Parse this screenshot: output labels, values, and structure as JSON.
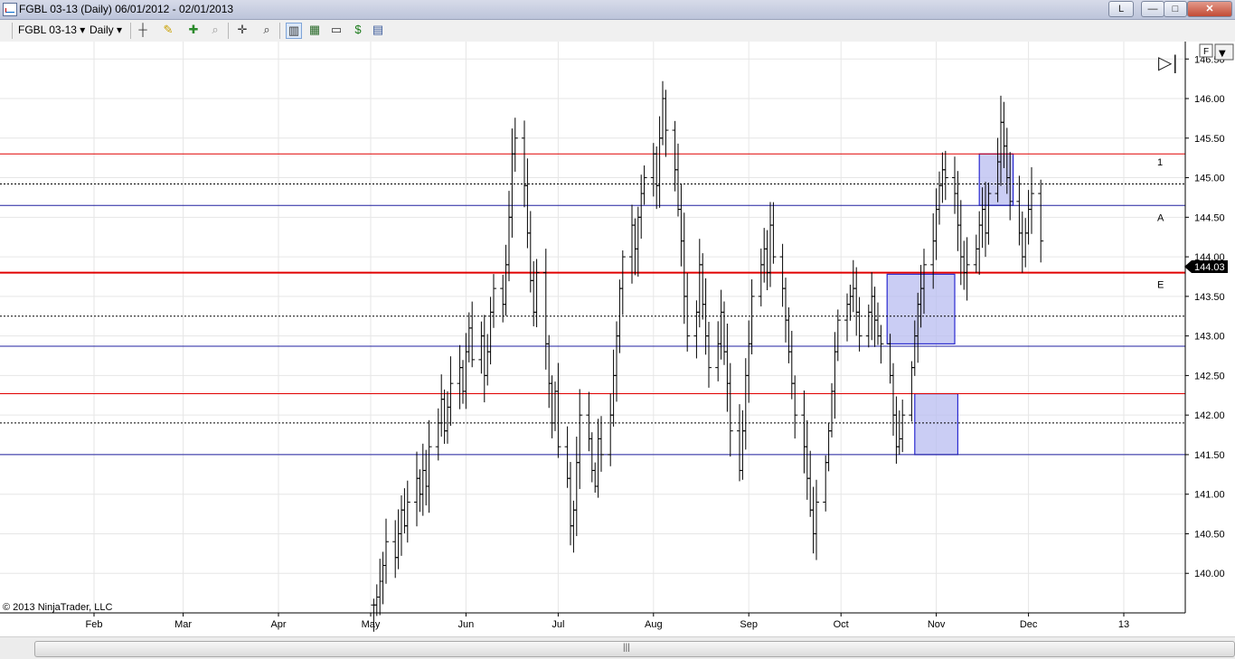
{
  "window": {
    "title": "FGBL 03-13 (Daily)  06/01/2012 - 02/01/2013",
    "buttons": {
      "layout": "L",
      "minimize": "—",
      "maximize": "□",
      "close": "✕"
    }
  },
  "toolbar": {
    "instrument": "FGBL 03-13",
    "period": "Daily",
    "icons": [
      "bar-style-icon",
      "drawing-pencil-icon",
      "add-indicator-icon",
      "zoom-icon",
      "crosshair-icon",
      "magnify-icon",
      "chart-bars-icon",
      "candlestick-icon",
      "chart-window-icon",
      "dollar-icon",
      "properties-icon"
    ]
  },
  "chart_controls": {
    "f_label": "F",
    "dropdown": "▼",
    "scroll_end": "▷|"
  },
  "copyright": "© 2013 NinjaTrader, LLC",
  "colors": {
    "red_line": "#e00000",
    "blue_line": "#2020a0",
    "black_line": "#000000",
    "box_fill": "#b8bcf0",
    "box_border": "#2a2ad0",
    "grid": "#e6e6e6",
    "bars": "#000000"
  },
  "chart_data": {
    "type": "bar",
    "title": "FGBL 03-13 (Daily)",
    "ylim": [
      139.5,
      146.72
    ],
    "y_ticks": [
      "146.50",
      "146.00",
      "145.50",
      "145.00",
      "144.50",
      "144.00",
      "143.50",
      "143.00",
      "142.50",
      "142.00",
      "141.50",
      "141.00",
      "140.50",
      "140.00"
    ],
    "x_ticks": [
      {
        "label": "Feb",
        "day": 0
      },
      {
        "label": "Mar",
        "day": 29
      },
      {
        "label": "Apr",
        "day": 60
      },
      {
        "label": "May",
        "day": 90
      },
      {
        "label": "Jun",
        "day": 121
      },
      {
        "label": "Jul",
        "day": 151
      },
      {
        "label": "Aug",
        "day": 182
      },
      {
        "label": "Sep",
        "day": 213
      },
      {
        "label": "Oct",
        "day": 243
      },
      {
        "label": "Nov",
        "day": 274
      },
      {
        "label": "Dec",
        "day": 304
      },
      {
        "label": "13",
        "day": 335
      }
    ],
    "current_price": "144.03",
    "horizontal_lines": [
      {
        "y": 145.3,
        "color": "red",
        "style": "solid",
        "width": 1
      },
      {
        "y": 144.92,
        "color": "black",
        "style": "dashed",
        "width": 1
      },
      {
        "y": 144.65,
        "color": "blue",
        "style": "solid",
        "width": 1
      },
      {
        "y": 143.8,
        "color": "red",
        "style": "solid",
        "width": 2
      },
      {
        "y": 143.25,
        "color": "black",
        "style": "dashed",
        "width": 1
      },
      {
        "y": 142.87,
        "color": "blue",
        "style": "solid",
        "width": 1
      },
      {
        "y": 142.27,
        "color": "red",
        "style": "solid",
        "width": 1
      },
      {
        "y": 141.9,
        "color": "black",
        "style": "dashed",
        "width": 1
      },
      {
        "y": 141.5,
        "color": "blue",
        "style": "solid",
        "width": 1
      }
    ],
    "line_labels": [
      {
        "text": "1",
        "y": 145.2
      },
      {
        "text": "A",
        "y": 144.5
      },
      {
        "text": "E",
        "y": 143.65
      }
    ],
    "zones": [
      {
        "day_start": 258,
        "day_end": 280,
        "y_low": 142.9,
        "y_high": 143.78
      },
      {
        "day_start": 267,
        "day_end": 281,
        "y_low": 141.5,
        "y_high": 142.27
      },
      {
        "day_start": 288,
        "day_end": 299,
        "y_low": 144.65,
        "y_high": 145.3
      }
    ],
    "bars_start_day": 91,
    "closes": [
      139.6,
      139.7,
      139.9,
      140.1,
      140.4,
      140.2,
      140.5,
      140.8,
      140.6,
      140.9,
      141.2,
      141.0,
      141.3,
      141.1,
      141.6,
      141.9,
      142.2,
      141.8,
      142.1,
      142.4,
      142.6,
      142.3,
      142.8,
      143.1,
      142.7,
      143.0,
      142.5,
      142.8,
      143.3,
      143.6,
      143.4,
      143.9,
      144.5,
      145.3,
      145.5,
      144.9,
      144.3,
      143.7,
      143.3,
      143.8,
      142.9,
      142.4,
      141.9,
      142.3,
      141.6,
      141.2,
      140.6,
      140.8,
      141.4,
      142.0,
      141.7,
      141.3,
      141.1,
      141.7,
      141.5,
      142.0,
      142.5,
      143.0,
      143.6,
      144.0,
      144.4,
      144.1,
      144.5,
      144.8,
      145.0,
      145.3,
      144.9,
      145.5,
      146.0,
      145.6,
      145.1,
      144.6,
      144.2,
      143.5,
      143.0,
      143.3,
      143.9,
      143.4,
      143.0,
      142.6,
      142.9,
      143.3,
      142.8,
      142.4,
      141.8,
      141.3,
      141.8,
      142.5,
      142.9,
      143.5,
      143.9,
      144.1,
      143.8,
      144.4,
      144.0,
      143.6,
      143.2,
      142.8,
      142.4,
      142.0,
      141.6,
      141.2,
      140.8,
      140.5,
      140.9,
      141.4,
      141.8,
      142.3,
      142.8,
      143.2,
      143.4,
      143.5,
      143.6,
      143.3,
      143.0,
      143.3,
      143.5,
      143.2,
      143.0,
      142.9,
      142.5,
      142.0,
      141.6,
      141.7,
      142.0,
      142.6,
      143.0,
      143.4,
      143.6,
      143.9,
      144.2,
      144.6,
      144.9,
      145.1,
      145.0,
      144.8,
      144.4,
      144.0,
      143.8,
      143.9,
      144.1,
      144.4,
      144.6,
      144.3,
      144.8,
      145.2,
      145.7,
      145.4,
      145.0,
      144.7,
      144.3,
      144.0,
      144.3,
      144.6,
      144.8,
      144.2
    ]
  }
}
